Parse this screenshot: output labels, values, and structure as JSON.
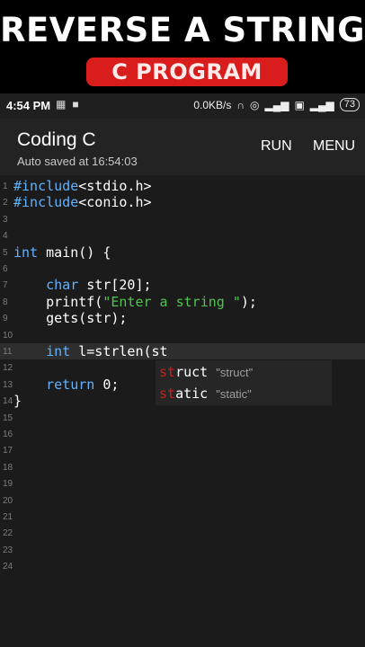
{
  "banner": {
    "title": "REVERSE A STRING",
    "subtitle": "C PROGRAM"
  },
  "status_bar": {
    "time": "4:54 PM",
    "speed": "0.0KB/s",
    "battery": "73"
  },
  "app_bar": {
    "title": "Coding C",
    "subtitle": "Auto saved at 16:54:03",
    "run_label": "RUN",
    "menu_label": "MENU"
  },
  "editor": {
    "current_line": 11,
    "lines": [
      {
        "no": "1",
        "parts": [
          {
            "t": "#include",
            "c": "kw"
          },
          {
            "t": "<stdio.h>"
          }
        ]
      },
      {
        "no": "2",
        "parts": [
          {
            "t": "#include",
            "c": "kw"
          },
          {
            "t": "<conio.h>"
          }
        ]
      },
      {
        "no": "3",
        "parts": []
      },
      {
        "no": "4",
        "parts": []
      },
      {
        "no": "5",
        "parts": [
          {
            "t": "int",
            "c": "kw"
          },
          {
            "t": " main() {"
          }
        ]
      },
      {
        "no": "6",
        "parts": []
      },
      {
        "no": "7",
        "parts": [
          {
            "t": "    "
          },
          {
            "t": "char",
            "c": "kw"
          },
          {
            "t": " str[20];"
          }
        ]
      },
      {
        "no": "8",
        "parts": [
          {
            "t": "    printf("
          },
          {
            "t": "\"Enter a string \"",
            "c": "str"
          },
          {
            "t": ");"
          }
        ]
      },
      {
        "no": "9",
        "parts": [
          {
            "t": "    gets(str);"
          }
        ]
      },
      {
        "no": "10",
        "parts": []
      },
      {
        "no": "11",
        "parts": [
          {
            "t": "    "
          },
          {
            "t": "int",
            "c": "kw"
          },
          {
            "t": " l=strlen(st"
          }
        ]
      },
      {
        "no": "12",
        "parts": []
      },
      {
        "no": "13",
        "parts": [
          {
            "t": "    "
          },
          {
            "t": "return",
            "c": "kw"
          },
          {
            "t": " 0;"
          }
        ]
      },
      {
        "no": "14",
        "parts": [
          {
            "t": "}"
          }
        ]
      },
      {
        "no": "15",
        "parts": []
      },
      {
        "no": "16",
        "parts": []
      },
      {
        "no": "17",
        "parts": []
      },
      {
        "no": "18",
        "parts": []
      },
      {
        "no": "19",
        "parts": []
      },
      {
        "no": "20",
        "parts": []
      },
      {
        "no": "21",
        "parts": []
      },
      {
        "no": "22",
        "parts": []
      },
      {
        "no": "23",
        "parts": []
      },
      {
        "no": "24",
        "parts": []
      }
    ]
  },
  "autocomplete": {
    "items": [
      {
        "match": "st",
        "rest": "ruct",
        "hint": "\"struct\""
      },
      {
        "match": "st",
        "rest": "atic",
        "hint": "\"static\""
      }
    ]
  }
}
